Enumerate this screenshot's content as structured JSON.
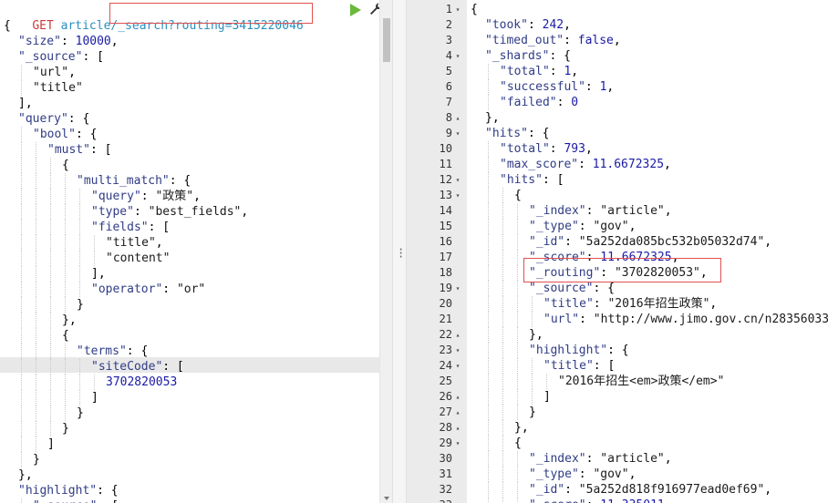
{
  "request": {
    "method": "GET",
    "path": "article/_search?routing=3415220046"
  },
  "left_lines": [
    {
      "i": 0,
      "segs": [
        [
          "p",
          "{"
        ]
      ]
    },
    {
      "i": 1,
      "segs": [
        [
          "k",
          "\"size\""
        ],
        [
          "p",
          ": "
        ],
        [
          "n",
          "10000"
        ],
        [
          "p",
          ","
        ]
      ]
    },
    {
      "i": 1,
      "segs": [
        [
          "k",
          "\"_source\""
        ],
        [
          "p",
          ": ["
        ]
      ]
    },
    {
      "i": 2,
      "segs": [
        [
          "s",
          "\"url\""
        ],
        [
          "p",
          ","
        ]
      ]
    },
    {
      "i": 2,
      "segs": [
        [
          "s",
          "\"title\""
        ]
      ]
    },
    {
      "i": 1,
      "segs": [
        [
          "p",
          "],"
        ]
      ]
    },
    {
      "i": 1,
      "segs": [
        [
          "k",
          "\"query\""
        ],
        [
          "p",
          ": {"
        ]
      ]
    },
    {
      "i": 2,
      "segs": [
        [
          "k",
          "\"bool\""
        ],
        [
          "p",
          ": {"
        ]
      ]
    },
    {
      "i": 3,
      "segs": [
        [
          "k",
          "\"must\""
        ],
        [
          "p",
          ": ["
        ]
      ]
    },
    {
      "i": 4,
      "segs": [
        [
          "p",
          "{"
        ]
      ]
    },
    {
      "i": 5,
      "segs": [
        [
          "k",
          "\"multi_match\""
        ],
        [
          "p",
          ": {"
        ]
      ]
    },
    {
      "i": 6,
      "segs": [
        [
          "k",
          "\"query\""
        ],
        [
          "p",
          ": "
        ],
        [
          "s",
          "\"政策\""
        ],
        [
          "p",
          ","
        ]
      ]
    },
    {
      "i": 6,
      "segs": [
        [
          "k",
          "\"type\""
        ],
        [
          "p",
          ": "
        ],
        [
          "s",
          "\"best_fields\""
        ],
        [
          "p",
          ","
        ]
      ]
    },
    {
      "i": 6,
      "segs": [
        [
          "k",
          "\"fields\""
        ],
        [
          "p",
          ": ["
        ]
      ]
    },
    {
      "i": 7,
      "segs": [
        [
          "s",
          "\"title\""
        ],
        [
          "p",
          ","
        ]
      ]
    },
    {
      "i": 7,
      "segs": [
        [
          "s",
          "\"content\""
        ]
      ]
    },
    {
      "i": 6,
      "segs": [
        [
          "p",
          "],"
        ]
      ]
    },
    {
      "i": 6,
      "segs": [
        [
          "k",
          "\"operator\""
        ],
        [
          "p",
          ": "
        ],
        [
          "s",
          "\"or\""
        ]
      ]
    },
    {
      "i": 5,
      "segs": [
        [
          "p",
          "}"
        ]
      ]
    },
    {
      "i": 4,
      "segs": [
        [
          "p",
          "},"
        ]
      ]
    },
    {
      "i": 4,
      "segs": [
        [
          "p",
          "{"
        ]
      ]
    },
    {
      "i": 5,
      "segs": [
        [
          "k",
          "\"terms\""
        ],
        [
          "p",
          ": {"
        ]
      ]
    },
    {
      "i": 6,
      "segs": [
        [
          "k",
          "\"siteCode\""
        ],
        [
          "p",
          ": ["
        ]
      ]
    },
    {
      "i": 7,
      "segs": [
        [
          "n",
          "3702820053"
        ]
      ]
    },
    {
      "i": 6,
      "segs": [
        [
          "p",
          "]"
        ]
      ]
    },
    {
      "i": 5,
      "segs": [
        [
          "p",
          "}"
        ]
      ]
    },
    {
      "i": 4,
      "segs": [
        [
          "p",
          "}"
        ]
      ]
    },
    {
      "i": 3,
      "segs": [
        [
          "p",
          "]"
        ]
      ]
    },
    {
      "i": 2,
      "segs": [
        [
          "p",
          "}"
        ]
      ]
    },
    {
      "i": 1,
      "segs": [
        [
          "p",
          "},"
        ]
      ]
    },
    {
      "i": 1,
      "segs": [
        [
          "k",
          "\"highlight\""
        ],
        [
          "p",
          ": {"
        ]
      ]
    },
    {
      "i": 2,
      "segs": [
        [
          "k",
          "\"_source\""
        ],
        [
          "p",
          ": ["
        ]
      ]
    }
  ],
  "right_lines": [
    {
      "n": 1,
      "f": "d",
      "i": 0,
      "segs": [
        [
          "p",
          "{"
        ]
      ]
    },
    {
      "n": 2,
      "f": "",
      "i": 1,
      "segs": [
        [
          "k",
          "\"took\""
        ],
        [
          "p",
          ": "
        ],
        [
          "n",
          "242"
        ],
        [
          "p",
          ","
        ]
      ]
    },
    {
      "n": 3,
      "f": "",
      "i": 1,
      "segs": [
        [
          "k",
          "\"timed_out\""
        ],
        [
          "p",
          ": "
        ],
        [
          "b",
          "false"
        ],
        [
          "p",
          ","
        ]
      ]
    },
    {
      "n": 4,
      "f": "d",
      "i": 1,
      "segs": [
        [
          "k",
          "\"_shards\""
        ],
        [
          "p",
          ": {"
        ]
      ]
    },
    {
      "n": 5,
      "f": "",
      "i": 2,
      "segs": [
        [
          "k",
          "\"total\""
        ],
        [
          "p",
          ": "
        ],
        [
          "n",
          "1"
        ],
        [
          "p",
          ","
        ]
      ]
    },
    {
      "n": 6,
      "f": "",
      "i": 2,
      "segs": [
        [
          "k",
          "\"successful\""
        ],
        [
          "p",
          ": "
        ],
        [
          "n",
          "1"
        ],
        [
          "p",
          ","
        ]
      ]
    },
    {
      "n": 7,
      "f": "",
      "i": 2,
      "segs": [
        [
          "k",
          "\"failed\""
        ],
        [
          "p",
          ": "
        ],
        [
          "n",
          "0"
        ]
      ]
    },
    {
      "n": 8,
      "f": "u",
      "i": 1,
      "segs": [
        [
          "p",
          "},"
        ]
      ]
    },
    {
      "n": 9,
      "f": "d",
      "i": 1,
      "segs": [
        [
          "k",
          "\"hits\""
        ],
        [
          "p",
          ": {"
        ]
      ]
    },
    {
      "n": 10,
      "f": "",
      "i": 2,
      "segs": [
        [
          "k",
          "\"total\""
        ],
        [
          "p",
          ": "
        ],
        [
          "n",
          "793"
        ],
        [
          "p",
          ","
        ]
      ]
    },
    {
      "n": 11,
      "f": "",
      "i": 2,
      "segs": [
        [
          "k",
          "\"max_score\""
        ],
        [
          "p",
          ": "
        ],
        [
          "n",
          "11.6672325"
        ],
        [
          "p",
          ","
        ]
      ]
    },
    {
      "n": 12,
      "f": "d",
      "i": 2,
      "segs": [
        [
          "k",
          "\"hits\""
        ],
        [
          "p",
          ": ["
        ]
      ]
    },
    {
      "n": 13,
      "f": "d",
      "i": 3,
      "segs": [
        [
          "p",
          "{"
        ]
      ]
    },
    {
      "n": 14,
      "f": "",
      "i": 4,
      "segs": [
        [
          "k",
          "\"_index\""
        ],
        [
          "p",
          ": "
        ],
        [
          "s",
          "\"article\""
        ],
        [
          "p",
          ","
        ]
      ]
    },
    {
      "n": 15,
      "f": "",
      "i": 4,
      "segs": [
        [
          "k",
          "\"_type\""
        ],
        [
          "p",
          ": "
        ],
        [
          "s",
          "\"gov\""
        ],
        [
          "p",
          ","
        ]
      ]
    },
    {
      "n": 16,
      "f": "",
      "i": 4,
      "segs": [
        [
          "k",
          "\"_id\""
        ],
        [
          "p",
          ": "
        ],
        [
          "s",
          "\"5a252da085bc532b05032d74\""
        ],
        [
          "p",
          ","
        ]
      ]
    },
    {
      "n": 17,
      "f": "",
      "i": 4,
      "segs": [
        [
          "k",
          "\"_score\""
        ],
        [
          "p",
          ": "
        ],
        [
          "n",
          "11.6672325"
        ],
        [
          "p",
          ","
        ]
      ]
    },
    {
      "n": 18,
      "f": "",
      "i": 4,
      "segs": [
        [
          "k",
          "\"_routing\""
        ],
        [
          "p",
          ": "
        ],
        [
          "s",
          "\"3702820053\""
        ],
        [
          "p",
          ","
        ]
      ]
    },
    {
      "n": 19,
      "f": "d",
      "i": 4,
      "segs": [
        [
          "k",
          "\"_source\""
        ],
        [
          "p",
          ": {"
        ]
      ]
    },
    {
      "n": 20,
      "f": "",
      "i": 5,
      "segs": [
        [
          "k",
          "\"title\""
        ],
        [
          "p",
          ": "
        ],
        [
          "s",
          "\"2016年招生政策\""
        ],
        [
          "p",
          ","
        ]
      ]
    },
    {
      "n": 21,
      "f": "",
      "i": 5,
      "segs": [
        [
          "k",
          "\"url\""
        ],
        [
          "p",
          ": "
        ],
        [
          "s",
          "\"http://www.jimo.gov.cn/n28356033/"
        ]
      ]
    },
    {
      "n": 22,
      "f": "u",
      "i": 4,
      "segs": [
        [
          "p",
          "},"
        ]
      ]
    },
    {
      "n": 23,
      "f": "d",
      "i": 4,
      "segs": [
        [
          "k",
          "\"highlight\""
        ],
        [
          "p",
          ": {"
        ]
      ]
    },
    {
      "n": 24,
      "f": "d",
      "i": 5,
      "segs": [
        [
          "k",
          "\"title\""
        ],
        [
          "p",
          ": ["
        ]
      ]
    },
    {
      "n": 25,
      "f": "",
      "i": 6,
      "segs": [
        [
          "s",
          "\"2016年招生<em>政策</em>\""
        ]
      ]
    },
    {
      "n": 26,
      "f": "u",
      "i": 5,
      "segs": [
        [
          "p",
          "]"
        ]
      ]
    },
    {
      "n": 27,
      "f": "u",
      "i": 4,
      "segs": [
        [
          "p",
          "}"
        ]
      ]
    },
    {
      "n": 28,
      "f": "u",
      "i": 3,
      "segs": [
        [
          "p",
          "},"
        ]
      ]
    },
    {
      "n": 29,
      "f": "d",
      "i": 3,
      "segs": [
        [
          "p",
          "{"
        ]
      ]
    },
    {
      "n": 30,
      "f": "",
      "i": 4,
      "segs": [
        [
          "k",
          "\"_index\""
        ],
        [
          "p",
          ": "
        ],
        [
          "s",
          "\"article\""
        ],
        [
          "p",
          ","
        ]
      ]
    },
    {
      "n": 31,
      "f": "",
      "i": 4,
      "segs": [
        [
          "k",
          "\"_type\""
        ],
        [
          "p",
          ": "
        ],
        [
          "s",
          "\"gov\""
        ],
        [
          "p",
          ","
        ]
      ]
    },
    {
      "n": 32,
      "f": "",
      "i": 4,
      "segs": [
        [
          "k",
          "\"_id\""
        ],
        [
          "p",
          ": "
        ],
        [
          "s",
          "\"5a252d818f916977ead0ef69\""
        ],
        [
          "p",
          ","
        ]
      ]
    },
    {
      "n": 33,
      "f": "",
      "i": 4,
      "segs": [
        [
          "k",
          "\"_score\""
        ],
        [
          "p",
          ": "
        ],
        [
          "n",
          "11.335011"
        ],
        [
          "p",
          ","
        ]
      ]
    }
  ],
  "icons": {
    "run": "play-icon",
    "settings": "wrench-icon",
    "resize": "drag-handle-icon"
  }
}
